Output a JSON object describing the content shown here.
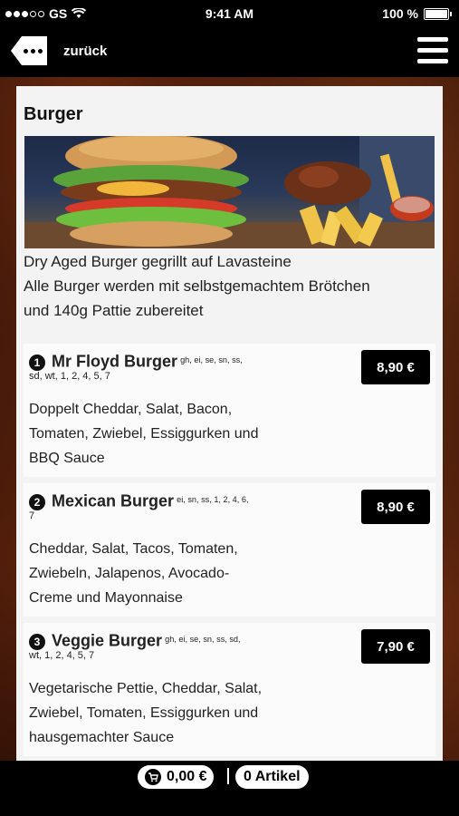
{
  "status_bar": {
    "carrier": "GS",
    "time": "9:41 AM",
    "battery": "100 %"
  },
  "nav": {
    "back_label": "zurück"
  },
  "category": {
    "title": "Burger",
    "image_alt": "burger-with-fries-photo",
    "description_lines": [
      "Dry Aged Burger gegrillt auf Lavasteine",
      "Alle Burger werden mit selbstgemachtem Brötchen",
      "und 140g Pattie zubereitet"
    ]
  },
  "items": [
    {
      "number": "1",
      "name": "Mr Floyd Burger",
      "allergens_line1": "gh, ei, se, sn, ss,",
      "allergens_line2": "sd, wt, 1, 2, 4, 5, 7",
      "price": "8,90 €",
      "desc_lines": [
        "Doppelt Cheddar, Salat, Bacon,",
        "Tomaten, Zwiebel, Essiggurken und",
        "BBQ Sauce"
      ]
    },
    {
      "number": "2",
      "name": "Mexican Burger",
      "allergens_line1": "ei, sn, ss, 1, 2, 4, 6,",
      "allergens_line2": "7",
      "price": "8,90 €",
      "desc_lines": [
        "Cheddar, Salat, Tacos, Tomaten,",
        "Zwiebeln, Jalapenos, Avocado-",
        "Creme und Mayonnaise"
      ]
    },
    {
      "number": "3",
      "name": "Veggie Burger",
      "allergens_line1": "gh, ei, se, sn, ss, sd,",
      "allergens_line2": "wt, 1, 2, 4, 5, 7",
      "price": "7,90 €",
      "desc_lines": [
        "Vegetarische Pettie, Cheddar, Salat,",
        "Zwiebel, Tomaten, Essiggurken und",
        "hausgemachter Sauce"
      ]
    }
  ],
  "cart": {
    "total": "0,00 €",
    "items_label": "0 Artikel"
  }
}
